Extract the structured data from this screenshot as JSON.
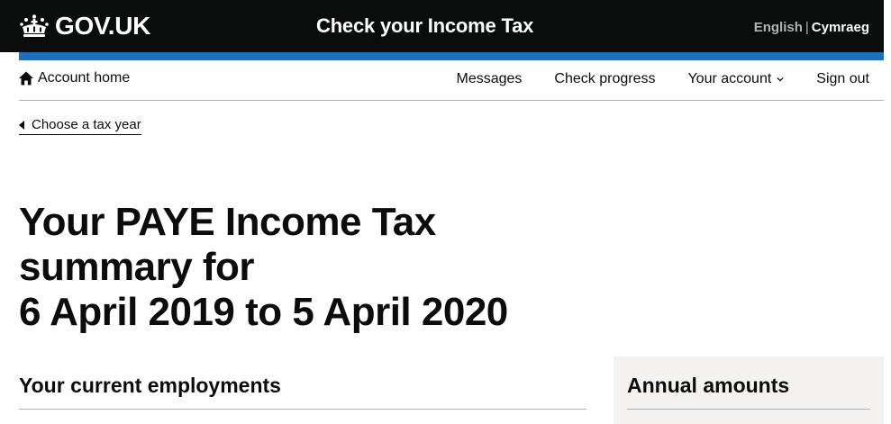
{
  "header": {
    "logo_text": "GOV.UK",
    "service_name": "Check your Income Tax",
    "language": {
      "english": "English",
      "separator": "|",
      "welsh": "Cymraeg"
    }
  },
  "account_nav": {
    "home": "Account home",
    "links": [
      "Messages",
      "Check progress",
      "Your account",
      "Sign out"
    ]
  },
  "back_link": "Choose a tax year",
  "page": {
    "title_lines": [
      "Your PAYE Income Tax",
      "summary for",
      "6 April 2019 to 5 April 2020"
    ]
  },
  "sections": {
    "employments_heading": "Your current employments",
    "annual_heading": "Annual amounts"
  },
  "colors": {
    "header_bg": "#0b0c0c",
    "brand_blue": "#1d70b8",
    "panel_bg": "#f3f2f1",
    "border": "#b1b4b6"
  }
}
